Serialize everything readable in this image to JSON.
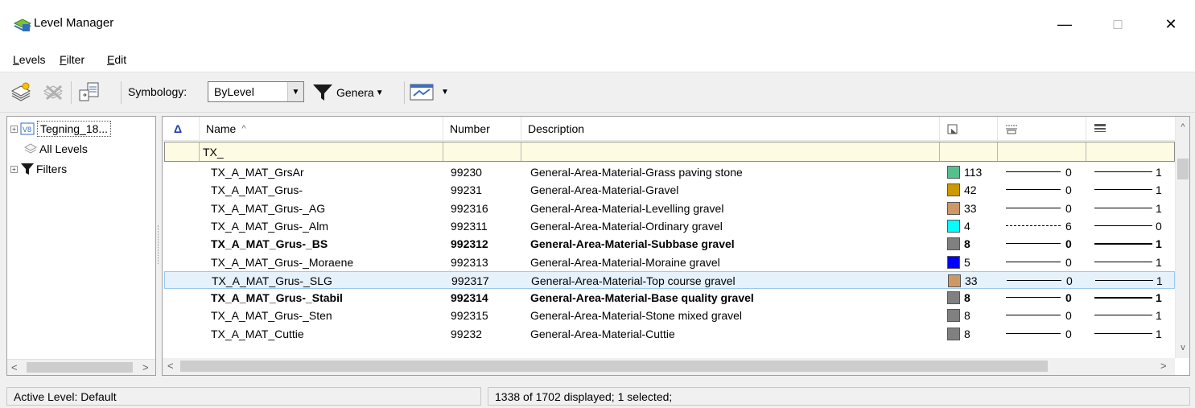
{
  "window": {
    "title": "Level Manager",
    "controls": {
      "minimize": "—",
      "maximize": "□",
      "close": "✕"
    }
  },
  "menu": [
    "Levels",
    "Filter",
    "Edit"
  ],
  "toolbar": {
    "symbology_label": "Symbology:",
    "symbology_value": "ByLevel",
    "filter_label": "Genera",
    "icons": [
      "new-level-icon",
      "delete-level-icon",
      "import-export-icon",
      "filter-funnel-icon",
      "level-display-icon"
    ]
  },
  "tree": {
    "root": "Tegning_18...",
    "all_levels": "All Levels",
    "filters": "Filters"
  },
  "grid": {
    "headers": {
      "flag": "Δ",
      "name": "Name",
      "number": "Number",
      "description": "Description"
    },
    "filter_value": "TX_",
    "rows": [
      {
        "name": "TX_A_MAT_GrsAr",
        "number": "99230",
        "description": "General-Area-Material-Grass paving stone",
        "color": "#54c08f",
        "color_index": "113",
        "style": "solid",
        "style_index": "0",
        "weight": "1",
        "bold": false
      },
      {
        "name": "TX_A_MAT_Grus-",
        "number": "99231",
        "description": "General-Area-Material-Gravel",
        "color": "#cc9900",
        "color_index": "42",
        "style": "solid",
        "style_index": "0",
        "weight": "1",
        "bold": false
      },
      {
        "name": "TX_A_MAT_Grus-_AG",
        "number": "992316",
        "description": "General-Area-Material-Levelling gravel",
        "color": "#cc9966",
        "color_index": "33",
        "style": "solid",
        "style_index": "0",
        "weight": "1",
        "bold": false
      },
      {
        "name": "TX_A_MAT_Grus-_Alm",
        "number": "992311",
        "description": "General-Area-Material-Ordinary gravel",
        "color": "#00ffff",
        "color_index": "4",
        "style": "dash",
        "style_index": "6",
        "weight": "0",
        "bold": false
      },
      {
        "name": "TX_A_MAT_Grus-_BS",
        "number": "992312",
        "description": "General-Area-Material-Subbase gravel",
        "color": "#808080",
        "color_index": "8",
        "style": "solid",
        "style_index": "0",
        "weight": "1",
        "bold": true
      },
      {
        "name": "TX_A_MAT_Grus-_Moraene",
        "number": "992313",
        "description": "General-Area-Material-Moraine gravel",
        "color": "#0000ff",
        "color_index": "5",
        "style": "solid",
        "style_index": "0",
        "weight": "1",
        "bold": false
      },
      {
        "name": "TX_A_MAT_Grus-_SLG",
        "number": "992317",
        "description": "General-Area-Material-Top course gravel",
        "color": "#cc9966",
        "color_index": "33",
        "style": "solid",
        "style_index": "0",
        "weight": "1",
        "bold": false,
        "selected": true
      },
      {
        "name": "TX_A_MAT_Grus-_Stabil",
        "number": "992314",
        "description": "General-Area-Material-Base quality gravel",
        "color": "#808080",
        "color_index": "8",
        "style": "solid",
        "style_index": "0",
        "weight": "1",
        "bold": true
      },
      {
        "name": "TX_A_MAT_Grus-_Sten",
        "number": "992315",
        "description": "General-Area-Material-Stone mixed gravel",
        "color": "#808080",
        "color_index": "8",
        "style": "solid",
        "style_index": "0",
        "weight": "1",
        "bold": false
      },
      {
        "name": "TX_A_MAT_Cuttie",
        "number": "99232",
        "description": "General-Area-Material-Cuttie",
        "color": "#808080",
        "color_index": "8",
        "style": "solid",
        "style_index": "0",
        "weight": "1",
        "bold": false
      }
    ]
  },
  "status": {
    "active_level": "Active Level: Default",
    "summary": "1338 of 1702 displayed; 1 selected;"
  }
}
